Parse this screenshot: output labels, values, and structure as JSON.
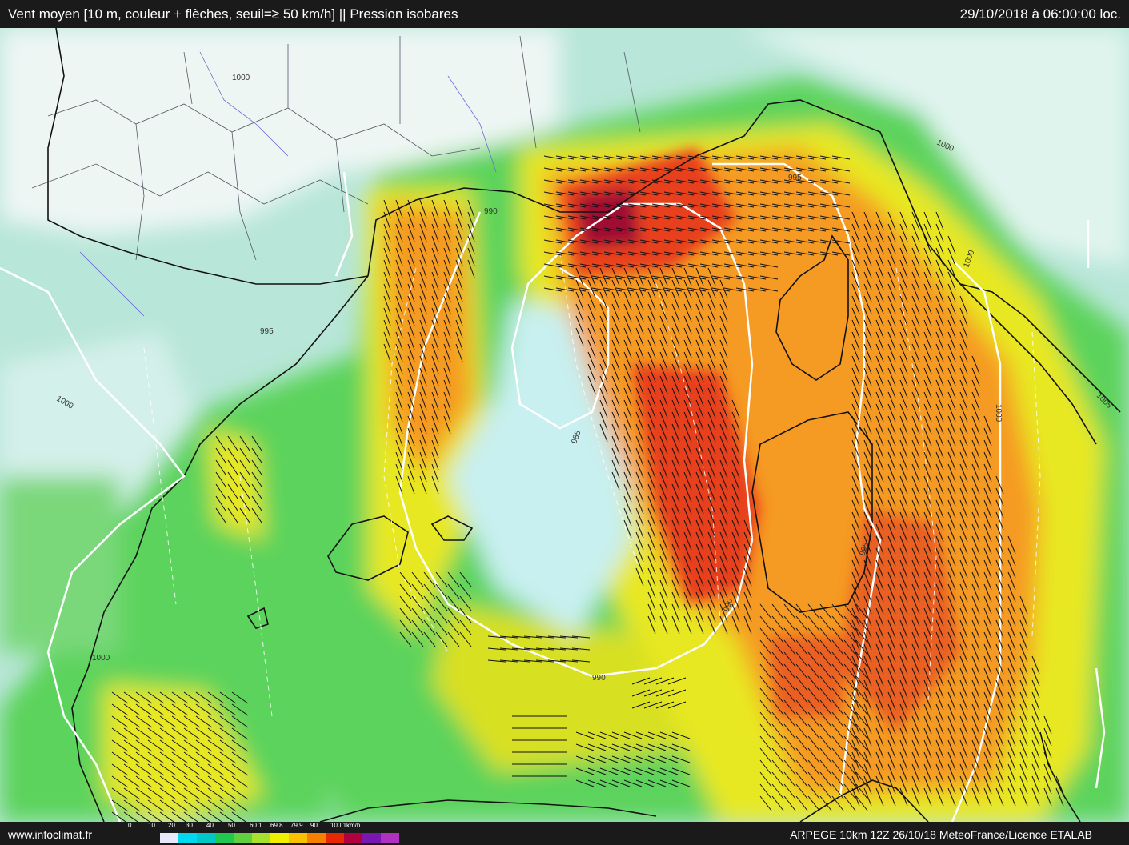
{
  "header": {
    "title": "Vent moyen [10 m, couleur + flèches, seuil=≥ 50 km/h] || Pression isobares",
    "datetime": "29/10/2018 à 06:00:00 loc."
  },
  "footer": {
    "site": "www.infoclimat.fr",
    "credits": "ARPEGE 10km 12Z 26/10/18 MeteoFrance/Licence ETALAB"
  },
  "legend": {
    "labels": [
      "0",
      "10",
      "20",
      "30",
      "40",
      "50",
      "60.1",
      "69.8",
      "79.9",
      "90",
      "100.1km/h"
    ],
    "colors": [
      "#e8e8f8",
      "#00d8f0",
      "#00c8c8",
      "#20c850",
      "#60d040",
      "#a8e030",
      "#f0f000",
      "#f8c000",
      "#f88000",
      "#e82800",
      "#b00040",
      "#7818b0",
      "#b030c0"
    ]
  },
  "isobar_labels": [
    "1000",
    "995",
    "990",
    "985",
    "1005"
  ],
  "colors": {
    "calm": "#b8e6d8",
    "green": "#5cd35c",
    "yellow": "#e8e820",
    "orange": "#f59a20",
    "red": "#e8401a",
    "darkred": "#a01030"
  }
}
